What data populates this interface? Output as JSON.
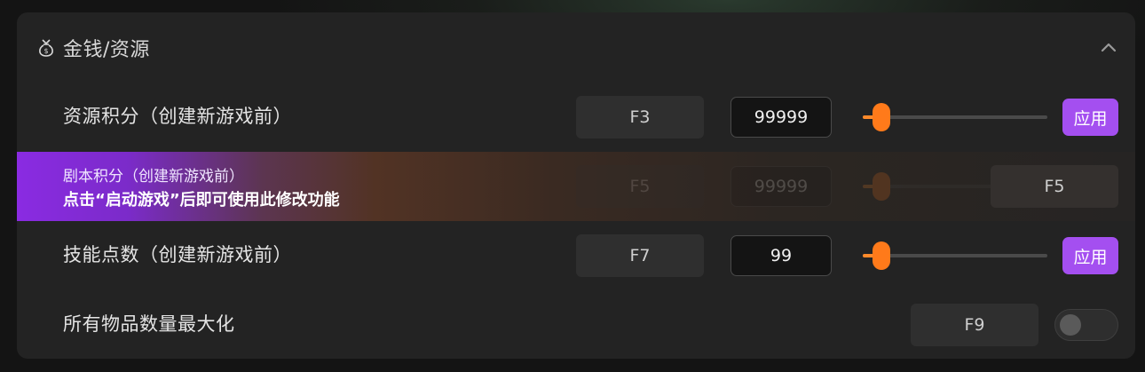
{
  "section": {
    "title": "金钱/资源",
    "icon": "money-bag-icon",
    "collapse_icon": "chevron-up-icon"
  },
  "rows": [
    {
      "label": "资源积分（创建新游戏前）",
      "hotkey": "F3",
      "value": "99999",
      "slider_fraction": 0.1,
      "apply_label": "应用"
    },
    {
      "label": "剧本积分（创建新游戏前）",
      "hotkey": "F5",
      "value": "99999",
      "notice": "点击“启动游戏”后即可使用此修改功能",
      "action_hotkey": "F5"
    },
    {
      "label": "技能点数（创建新游戏前）",
      "hotkey": "F7",
      "value": "99",
      "slider_fraction": 0.1,
      "apply_label": "应用"
    },
    {
      "label": "所有物品数量最大化",
      "hotkey": "F9",
      "toggle_on": false
    }
  ],
  "colors": {
    "accent_purple": "#a44ff0",
    "slider_orange": "#ff7a1a"
  }
}
